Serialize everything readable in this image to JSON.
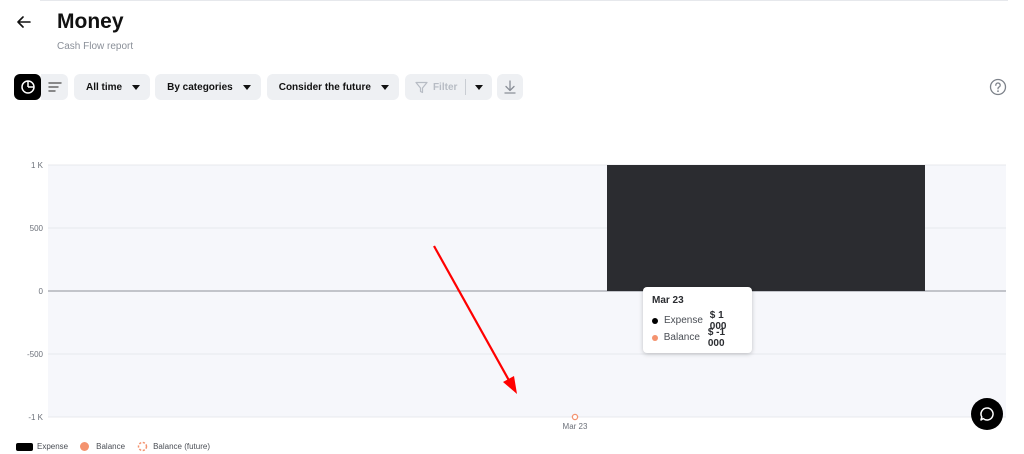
{
  "header": {
    "title": "Money",
    "subtitle": "Cash Flow report"
  },
  "toolbar": {
    "period": "All time",
    "grouping": "By categories",
    "future": "Consider the future",
    "filter": "Filter"
  },
  "icons": {
    "back": "arrow-left-icon",
    "chart_view": "pie-chart-icon",
    "list_view": "list-lines-icon",
    "filter": "funnel-icon",
    "download": "download-icon",
    "help": "help-circle-icon",
    "chat": "chat-bubble-icon"
  },
  "colors": {
    "expense": "#2b2c30",
    "balance": "#f4936f",
    "annotation_arrow": "#ff0000",
    "plot_bg": "#f6f7fb"
  },
  "chart_data": {
    "type": "bar",
    "categories": [
      "Mar 23"
    ],
    "ylim": [
      -1000,
      1000
    ],
    "yticks": [
      1000,
      500,
      0,
      -500,
      -1000
    ],
    "ytick_labels": [
      "1 K",
      "500",
      "0",
      "-500",
      "-1 K"
    ],
    "series": [
      {
        "name": "Expense",
        "type": "bar",
        "values": [
          1000
        ]
      },
      {
        "name": "Balance",
        "type": "point",
        "values": [
          -1000
        ]
      },
      {
        "name": "Balance (future)",
        "type": "point",
        "values": []
      }
    ],
    "legend": [
      "Expense",
      "Balance",
      "Balance (future)"
    ],
    "legend_position": "bottom-left",
    "grid": true
  },
  "tooltip": {
    "date": "Mar 23",
    "rows": [
      {
        "label": "Expense",
        "value": "$ 1 000"
      },
      {
        "label": "Balance",
        "value": "$ -1 000"
      }
    ]
  }
}
